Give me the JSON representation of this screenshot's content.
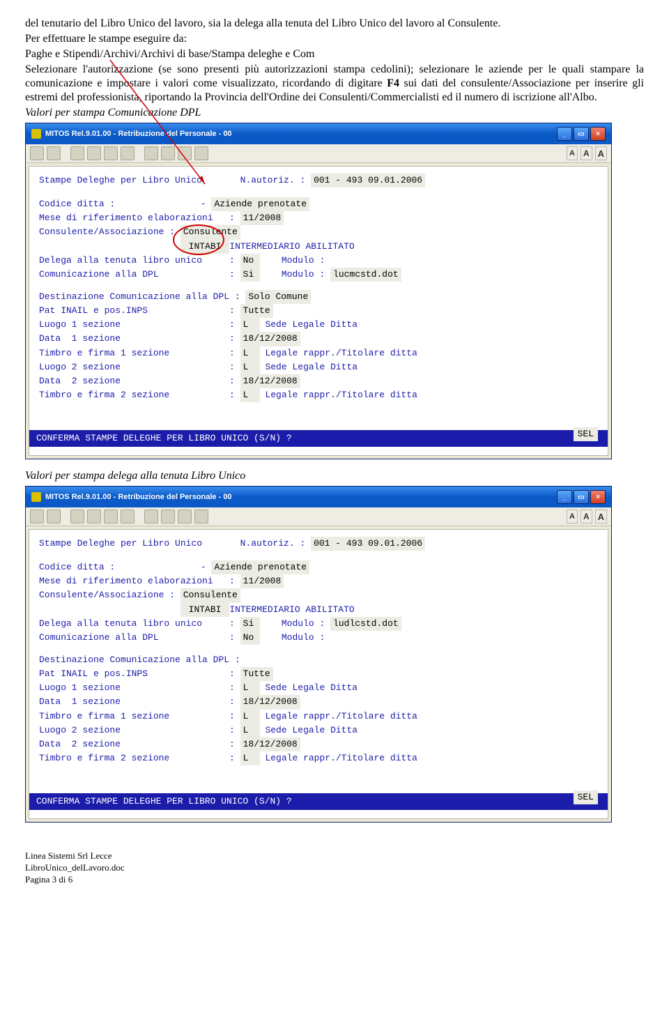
{
  "intro": {
    "p1": "del tenutario del Libro Unico del lavoro, sia la delega alla tenuta del Libro Unico del lavoro  al Consulente.",
    "p2": "Per effettuare le stampe eseguire da:",
    "p3": "Paghe e Stipendi/Archivi/Archivi di base/Stampa deleghe e Com",
    "p4_a": "Selezionare l'autorizzazione (se sono presenti più autorizzazioni stampa cedolini); selezionare le aziende per le quali stampare la  comunicazione  e impostare i valori come visualizzato, ricordando di digitare  ",
    "p4_f4": "F4",
    "p4_b": "  sui dati del consulente/Associazione per inserire gli estremi del professionista, riportando la  Provincia  dell'Ordine dei Consulenti/Commercialisti ed  il numero di iscrizione all'Albo.",
    "caption1": "Valori per stampa Comunicazione DPL",
    "caption2": "Valori per stampa delega alla tenuta Libro Unico"
  },
  "win_title": "MITOS  Rel.9.01.00 - Retribuzione del Personale - 00",
  "win_buttons": {
    "min": "_",
    "max": "▭",
    "close": "×"
  },
  "toolbar_a": [
    "A",
    "A",
    "A"
  ],
  "shared": {
    "heading_prefix": "Stampe Deleghe per Libro Unico       N.autoriz. : ",
    "heading_value": "001 - 493 09.01.2006",
    "codice_ditta_label": "Codice ditta : ",
    "codice_ditta_value": "",
    "codice_ditta_suffix": "      - ",
    "aziende_prenotate": "Aziende prenotate",
    "mese_label": "Mese di riferimento elaborazioni   : ",
    "mese_value": "11/2008",
    "cons_label": "Consulente/Associazione : ",
    "cons_value": "Consulente",
    "intabi_label": "                          ",
    "intabi_value": " INTABI ",
    "intabi_suffix": "INTERMEDIARIO ABILITATO",
    "delega_label": "Delega alla tenuta libro unico     : ",
    "modulo_label": "    Modulo : ",
    "com_dpl_label": "Comunicazione alla DPL             : ",
    "dest_label": "Destinazione Comunicazione alla DPL : ",
    "pat_label": "Pat INAIL e pos.INPS               : ",
    "luogo1_label": "Luogo 1 sezione                    : ",
    "data1_label": "Data  1 sezione                    : ",
    "timbro1_label": "Timbro e firma 1 sezione           : ",
    "luogo2_label": "Luogo 2 sezione                    : ",
    "data2_label": "Data  2 sezione                    : ",
    "timbro2_label": "Timbro e firma 2 sezione           : ",
    "pat_value": "Tutte",
    "luogo_l": "L",
    "luogo_suffix": " Sede Legale Ditta",
    "data_value": "18/12/2008",
    "timbro_l": "L",
    "timbro_suffix": " Legale rappr./Titolare ditta",
    "sel": "SEL",
    "confirm": "        CONFERMA STAMPE DELEGHE PER LIBRO UNICO  (S/N) ? "
  },
  "screen1": {
    "delega_value": "No",
    "delega_modulo": "",
    "com_dpl_value": "Si",
    "com_dpl_modulo": "lucmcstd.dot",
    "dest_value": "Solo Comune"
  },
  "screen2": {
    "delega_value": "Si",
    "delega_modulo": "ludlcstd.dot",
    "com_dpl_value": "No",
    "com_dpl_modulo": "",
    "dest_value": ""
  },
  "footer": {
    "line1": "Linea Sistemi  Srl Lecce",
    "line2": "LibroUnico_delLavoro.doc",
    "line3": "Pagina 3 di 6"
  }
}
